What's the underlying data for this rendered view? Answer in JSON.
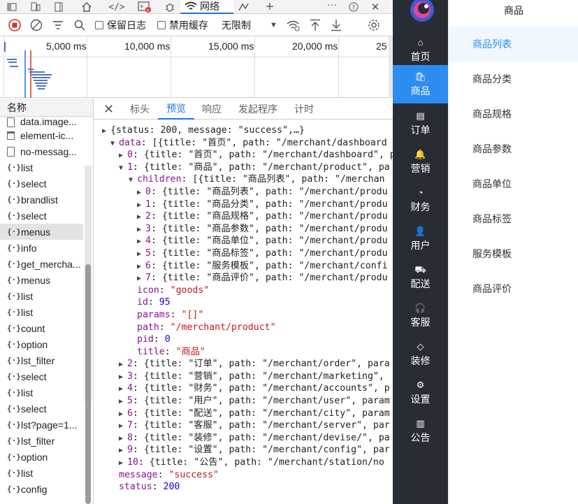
{
  "devtools": {
    "tabbar": {
      "network_label": "网络",
      "icons": [
        "dock-icon",
        "device-toolbar-icon",
        "panel-icon",
        "welcome-icon",
        "elements-icon",
        "console-icon",
        "sources-icon",
        "network-icon",
        "performance-icon",
        "add-tab-icon",
        "more-icon",
        "help-icon",
        "close-icon"
      ]
    },
    "toolbar": {
      "preserve_log": "保留日志",
      "disable_cache": "禁用缓存",
      "throttling": "无限制"
    },
    "timeline": {
      "ticks": [
        "5,000 ms",
        "10,000 ms",
        "15,000 ms",
        "20,000 ms",
        "25"
      ]
    },
    "requests": {
      "header": "名称",
      "items": [
        {
          "name": "data.image...",
          "type": "doc"
        },
        {
          "name": "element-ic...",
          "type": "img"
        },
        {
          "name": "no-messag...",
          "type": "doc"
        },
        {
          "name": "list",
          "type": "xhr"
        },
        {
          "name": "select",
          "type": "xhr"
        },
        {
          "name": "brandlist",
          "type": "xhr"
        },
        {
          "name": "select",
          "type": "xhr"
        },
        {
          "name": "menus",
          "type": "xhr",
          "selected": true
        },
        {
          "name": "info",
          "type": "xhr"
        },
        {
          "name": "get_mercha...",
          "type": "xhr"
        },
        {
          "name": "menus",
          "type": "xhr"
        },
        {
          "name": "list",
          "type": "xhr"
        },
        {
          "name": "list",
          "type": "xhr"
        },
        {
          "name": "count",
          "type": "xhr"
        },
        {
          "name": "option",
          "type": "xhr"
        },
        {
          "name": "lst_filter",
          "type": "xhr"
        },
        {
          "name": "select",
          "type": "xhr"
        },
        {
          "name": "list",
          "type": "xhr"
        },
        {
          "name": "select",
          "type": "xhr"
        },
        {
          "name": "lst?page=1...",
          "type": "xhr"
        },
        {
          "name": "lst_filter",
          "type": "xhr"
        },
        {
          "name": "option",
          "type": "xhr"
        },
        {
          "name": "list",
          "type": "xhr"
        },
        {
          "name": "config",
          "type": "xhr"
        }
      ]
    },
    "pane_tabs": {
      "headers": "标头",
      "preview": "预览",
      "response": "响应",
      "initiator": "发起程序",
      "timing": "计时"
    },
    "preview": {
      "lines": [
        {
          "indent": 0,
          "tri": "▶",
          "text": "{status: 200, message: \"success\",…}"
        },
        {
          "indent": 1,
          "tri": "▼",
          "key": "data",
          "text": ": [{title: \"首页\", path: \"/merchant/dashboard"
        },
        {
          "indent": 2,
          "tri": "▶",
          "key": "0",
          "text": ": {title: \"首页\", path: \"/merchant/dashboard\", p"
        },
        {
          "indent": 2,
          "tri": "▼",
          "key": "1",
          "text": ": {title: \"商品\", path: \"/merchant/product\", pa"
        },
        {
          "indent": 3,
          "tri": "▼",
          "key": "children",
          "text": ": [{title: \"商品列表\", path: \"/merchan"
        },
        {
          "indent": 4,
          "tri": "▶",
          "key": "0",
          "text": ": {title: \"商品列表\", path: \"/merchant/produ"
        },
        {
          "indent": 4,
          "tri": "▶",
          "key": "1",
          "text": ": {title: \"商品分类\", path: \"/merchant/produ"
        },
        {
          "indent": 4,
          "tri": "▶",
          "key": "2",
          "text": ": {title: \"商品规格\", path: \"/merchant/produ"
        },
        {
          "indent": 4,
          "tri": "▶",
          "key": "3",
          "text": ": {title: \"商品参数\", path: \"/merchant/produ"
        },
        {
          "indent": 4,
          "tri": "▶",
          "key": "4",
          "text": ": {title: \"商品单位\", path: \"/merchant/produ"
        },
        {
          "indent": 4,
          "tri": "▶",
          "key": "5",
          "text": ": {title: \"商品标签\", path: \"/merchant/produ"
        },
        {
          "indent": 4,
          "tri": "▶",
          "key": "6",
          "text": ": {title: \"服务模板\", path: \"/merchant/confi"
        },
        {
          "indent": 4,
          "tri": "▶",
          "key": "7",
          "text": ": {title: \"商品评价\", path: \"/merchant/produ"
        },
        {
          "indent": 3,
          "tri": "",
          "key": "icon",
          "sep": ": ",
          "val": "\"goods\"",
          "vt": "s"
        },
        {
          "indent": 3,
          "tri": "",
          "key": "id",
          "sep": ": ",
          "val": "95",
          "vt": "n"
        },
        {
          "indent": 3,
          "tri": "",
          "key": "params",
          "sep": ": ",
          "val": "\"[]\"",
          "vt": "s"
        },
        {
          "indent": 3,
          "tri": "",
          "key": "path",
          "sep": ": ",
          "val": "\"/merchant/product\"",
          "vt": "s"
        },
        {
          "indent": 3,
          "tri": "",
          "key": "pid",
          "sep": ": ",
          "val": "0",
          "vt": "n"
        },
        {
          "indent": 3,
          "tri": "",
          "key": "title",
          "sep": ": ",
          "val": "\"商品\"",
          "vt": "s"
        },
        {
          "indent": 2,
          "tri": "▶",
          "key": "2",
          "text": ": {title: \"订单\", path: \"/merchant/order\", para"
        },
        {
          "indent": 2,
          "tri": "▶",
          "key": "3",
          "text": ": {title: \"营销\", path: \"/merchant/marketing\","
        },
        {
          "indent": 2,
          "tri": "▶",
          "key": "4",
          "text": ": {title: \"财务\", path: \"/merchant/accounts\", p"
        },
        {
          "indent": 2,
          "tri": "▶",
          "key": "5",
          "text": ": {title: \"用户\", path: \"/merchant/user\", param"
        },
        {
          "indent": 2,
          "tri": "▶",
          "key": "6",
          "text": ": {title: \"配送\", path: \"/merchant/city\", param"
        },
        {
          "indent": 2,
          "tri": "▶",
          "key": "7",
          "text": ": {title: \"客服\", path: \"/merchant/server\", par"
        },
        {
          "indent": 2,
          "tri": "▶",
          "key": "8",
          "text": ": {title: \"装修\", path: \"/merchant/devise/\", pa"
        },
        {
          "indent": 2,
          "tri": "▶",
          "key": "9",
          "text": ": {title: \"设置\", path: \"/merchant/config\", par"
        },
        {
          "indent": 2,
          "tri": "▶",
          "key": "10",
          "text": ": {title: \"公告\", path: \"/merchant/station/no"
        },
        {
          "indent": 1,
          "tri": "",
          "key": "message",
          "sep": ": ",
          "val": "\"success\"",
          "vt": "s"
        },
        {
          "indent": 1,
          "tri": "",
          "key": "status",
          "sep": ": ",
          "val": "200",
          "vt": "n"
        }
      ]
    }
  },
  "app": {
    "nav": [
      {
        "label": "首页",
        "icon": "home-icon"
      },
      {
        "label": "商品",
        "icon": "bag-icon",
        "active": true
      },
      {
        "label": "订单",
        "icon": "order-icon"
      },
      {
        "label": "营销",
        "icon": "bell-icon"
      },
      {
        "label": "财务",
        "icon": "finance-icon"
      },
      {
        "label": "用户",
        "icon": "user-icon"
      },
      {
        "label": "配送",
        "icon": "truck-icon"
      },
      {
        "label": "客服",
        "icon": "headset-icon"
      },
      {
        "label": "装修",
        "icon": "decor-icon"
      },
      {
        "label": "设置",
        "icon": "gear-icon"
      },
      {
        "label": "公告",
        "icon": "notice-icon"
      }
    ],
    "submenu": {
      "title": "商品",
      "items": [
        {
          "label": "商品列表",
          "active": true
        },
        {
          "label": "商品分类"
        },
        {
          "label": "商品规格"
        },
        {
          "label": "商品参数"
        },
        {
          "label": "商品单位"
        },
        {
          "label": "商品标签"
        },
        {
          "label": "服务模板"
        },
        {
          "label": "商品评价"
        }
      ]
    },
    "colors": {
      "accent": "#2d8cf0",
      "nav_bg": "#282c34",
      "devtools_accent": "#1a73e8"
    }
  }
}
